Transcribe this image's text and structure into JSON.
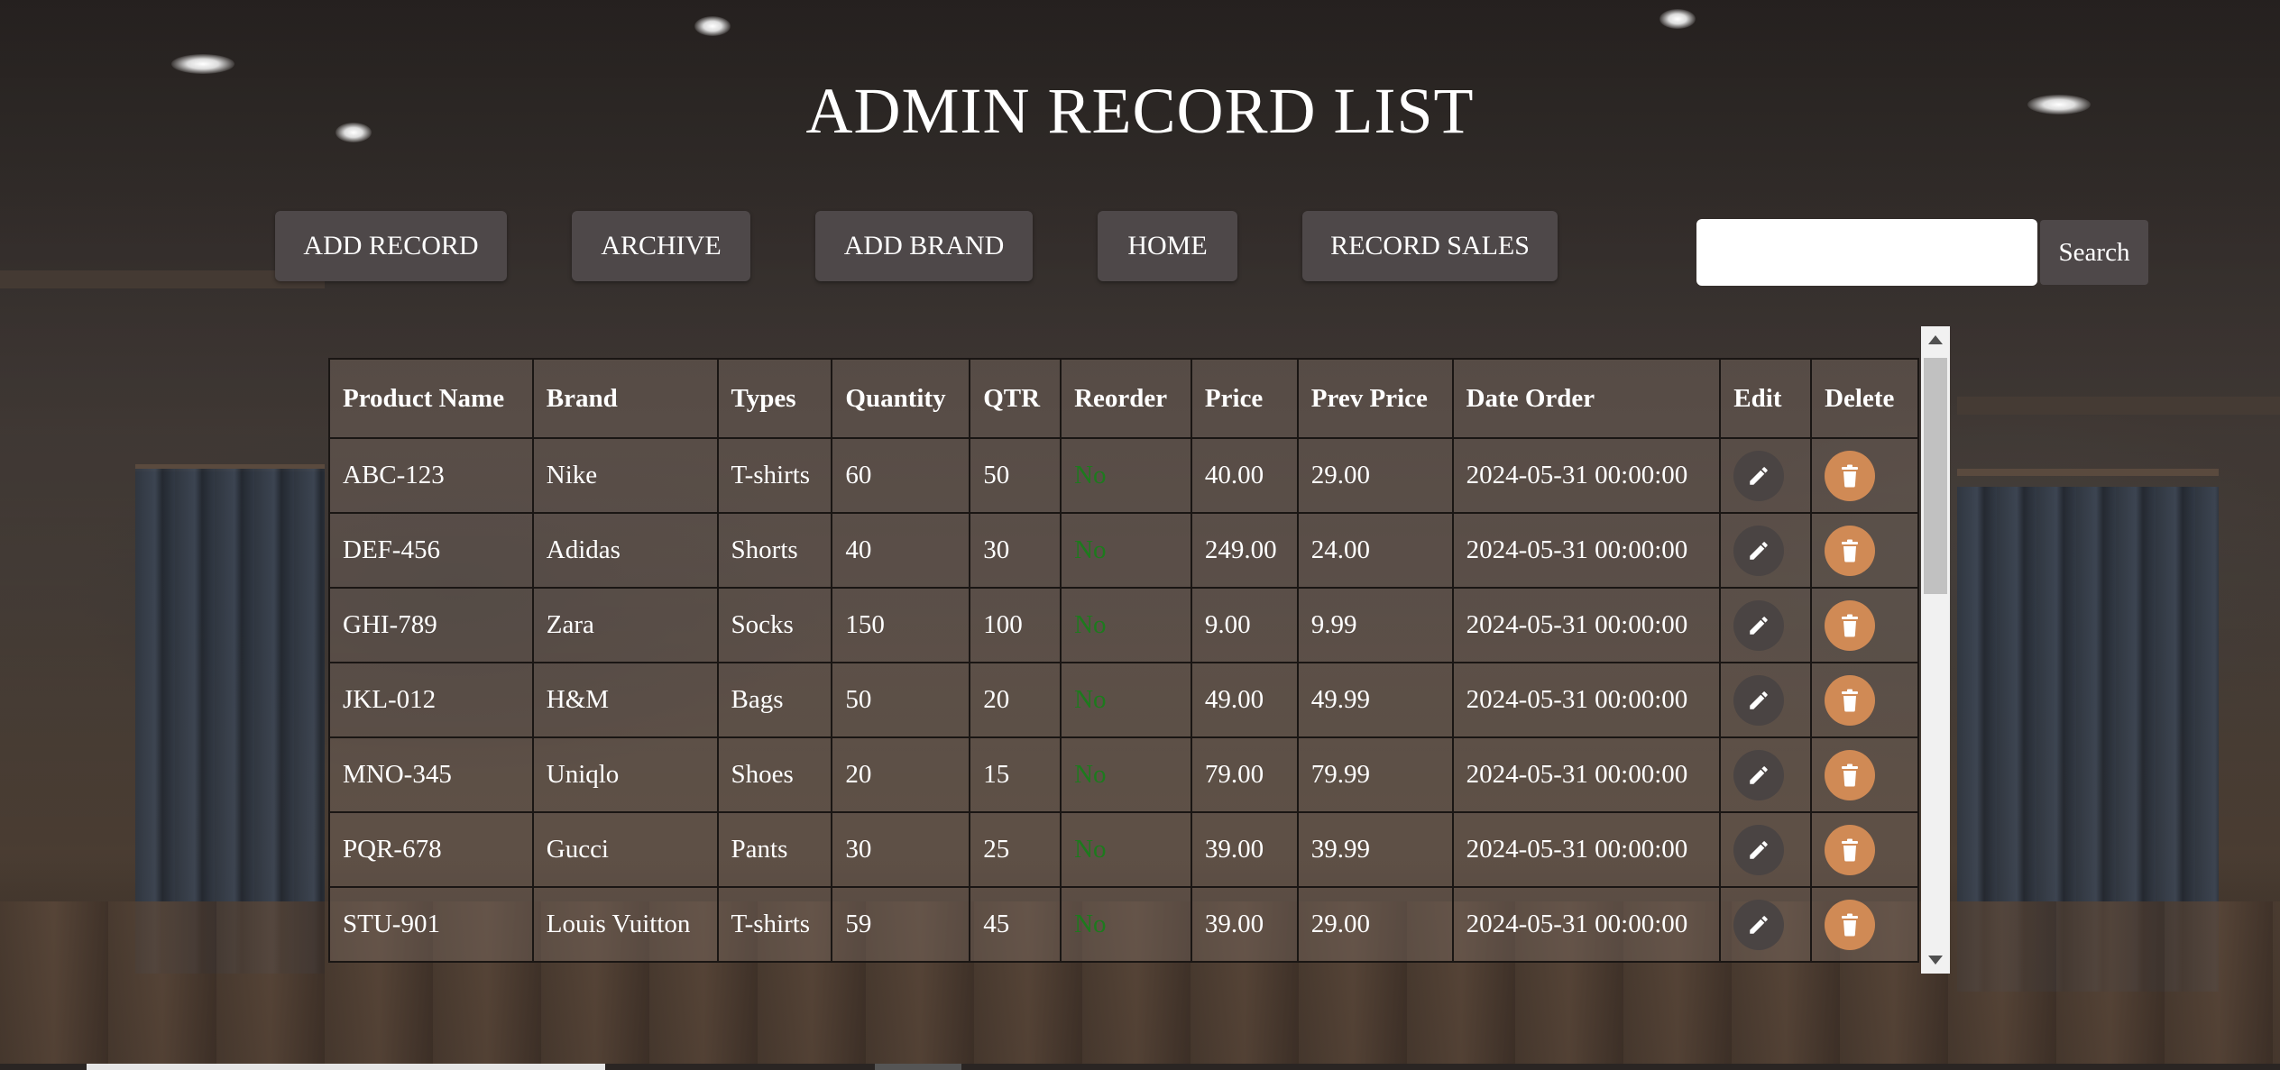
{
  "page": {
    "title": "ADMIN RECORD LIST"
  },
  "nav": {
    "add_record": "ADD RECORD",
    "archive": "ARCHIVE",
    "add_brand": "ADD BRAND",
    "home": "HOME",
    "record_sales": "RECORD SALES"
  },
  "search": {
    "value": "",
    "button": "Search"
  },
  "table": {
    "headers": [
      "Product Name",
      "Brand",
      "Types",
      "Quantity",
      "QTR",
      "Reorder",
      "Price",
      "Prev Price",
      "Date Order",
      "Edit",
      "Delete"
    ],
    "rows": [
      {
        "product": "ABC-123",
        "brand": "Nike",
        "type": "T-shirts",
        "quantity": "60",
        "qtr": "50",
        "reorder": "No",
        "price": "40.00",
        "prev_price": "29.00",
        "date_order": "2024-05-31 00:00:00"
      },
      {
        "product": "DEF-456",
        "brand": "Adidas",
        "type": "Shorts",
        "quantity": "40",
        "qtr": "30",
        "reorder": "No",
        "price": "249.00",
        "prev_price": "24.00",
        "date_order": "2024-05-31 00:00:00"
      },
      {
        "product": "GHI-789",
        "brand": "Zara",
        "type": "Socks",
        "quantity": "150",
        "qtr": "100",
        "reorder": "No",
        "price": "9.00",
        "prev_price": "9.99",
        "date_order": "2024-05-31 00:00:00"
      },
      {
        "product": "JKL-012",
        "brand": "H&M",
        "type": "Bags",
        "quantity": "50",
        "qtr": "20",
        "reorder": "No",
        "price": "49.00",
        "prev_price": "49.99",
        "date_order": "2024-05-31 00:00:00"
      },
      {
        "product": "MNO-345",
        "brand": "Uniqlo",
        "type": "Shoes",
        "quantity": "20",
        "qtr": "15",
        "reorder": "No",
        "price": "79.00",
        "prev_price": "79.99",
        "date_order": "2024-05-31 00:00:00"
      },
      {
        "product": "PQR-678",
        "brand": "Gucci",
        "type": "Pants",
        "quantity": "30",
        "qtr": "25",
        "reorder": "No",
        "price": "39.00",
        "prev_price": "39.99",
        "date_order": "2024-05-31 00:00:00"
      },
      {
        "product": "STU-901",
        "brand": "Louis Vuitton",
        "type": "T-shirts",
        "quantity": "59",
        "qtr": "45",
        "reorder": "No",
        "price": "39.00",
        "prev_price": "29.00",
        "date_order": "2024-05-31 00:00:00"
      }
    ]
  },
  "icons": {
    "edit": "pencil-icon",
    "delete": "trash-icon"
  },
  "colors": {
    "reorder_text": "#1d7a1d",
    "delete_button": "#d08a55",
    "edit_button": "#4a4443",
    "nav_button": "#4e4849"
  }
}
